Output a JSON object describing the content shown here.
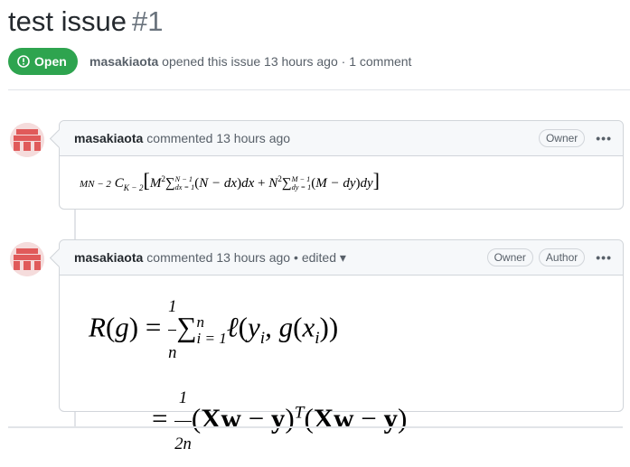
{
  "issue": {
    "title": "test issue",
    "number": "#1",
    "state_label": "Open",
    "author": "masakiaota",
    "opened_text": "opened this issue 13 hours ago · 1 comment"
  },
  "comments": [
    {
      "author": "masakiaota",
      "meta": "commented 13 hours ago",
      "edited": "",
      "labels": [
        "Owner"
      ],
      "more": "•••"
    },
    {
      "author": "masakiaota",
      "meta": "commented 13 hours ago",
      "edited": "• edited ▾",
      "labels": [
        "Owner",
        "Author"
      ],
      "more": "•••"
    }
  ],
  "colors": {
    "open_green": "#2ea44f",
    "border": "#d1d5da",
    "header_bg": "#f6f8fa",
    "avatar_red": "#e05a5a"
  },
  "icons": [
    "issue-opened-icon",
    "kebab-icon",
    "caret-down-icon",
    "avatar-identicon"
  ]
}
